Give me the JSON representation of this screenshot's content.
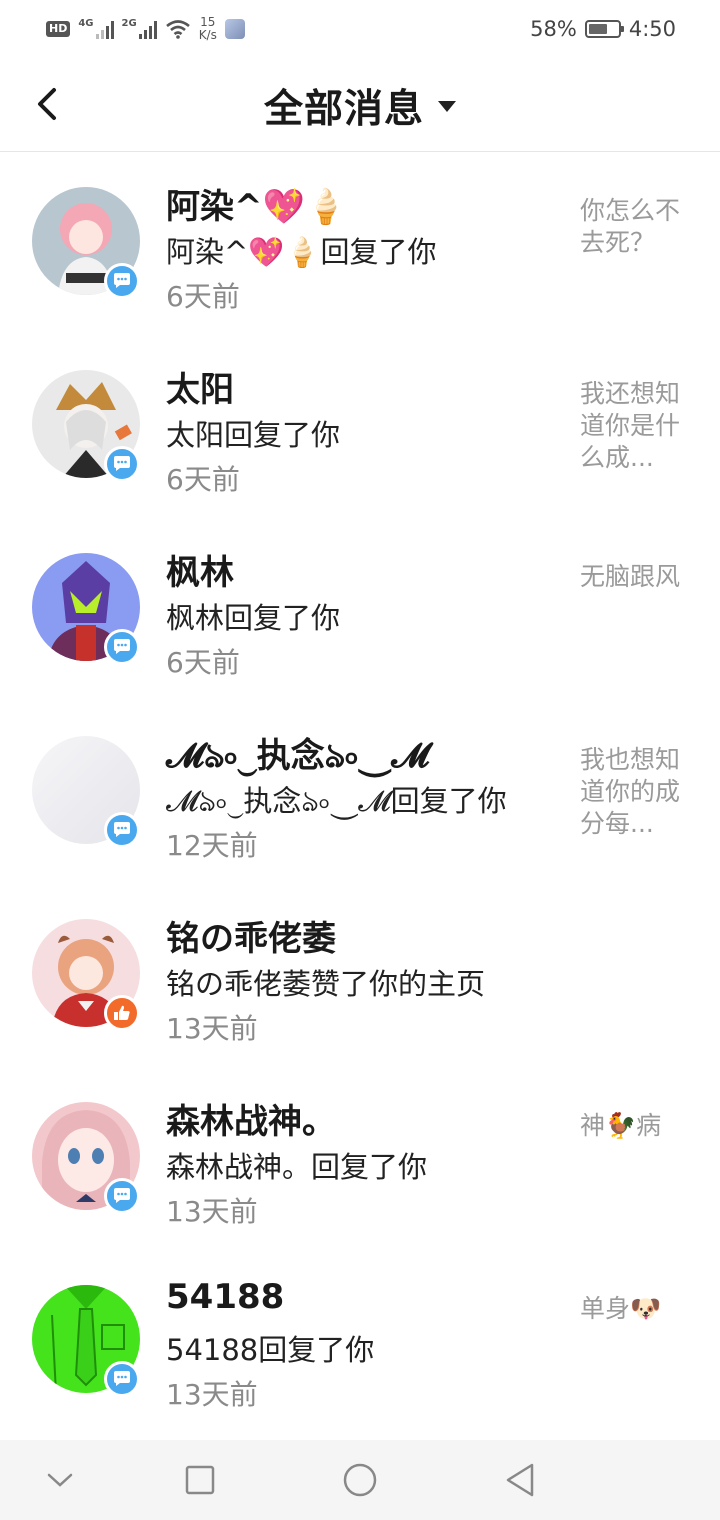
{
  "status_bar": {
    "hd": "HD",
    "net1": "4G",
    "net2": "2G",
    "speed_value": "15",
    "speed_unit": "K/s",
    "battery": "58%",
    "time": "4:50"
  },
  "header": {
    "title": "全部消息",
    "back_icon": "chevron-left-icon",
    "dropdown_icon": "caret-down-icon"
  },
  "messages": [
    {
      "name": "阿染^💖🍦",
      "action": "阿染^💖🍦回复了你",
      "time": "6天前",
      "preview": "你怎么不去死？",
      "badge": "reply"
    },
    {
      "name": "太阳",
      "action": "太阳回复了你",
      "time": "6天前",
      "preview": "我还想知道你是什么成...",
      "badge": "reply"
    },
    {
      "name": "枫林",
      "action": "枫林回复了你",
      "time": "6天前",
      "preview": "无脑跟风",
      "badge": "reply"
    },
    {
      "name": "𝓜ঌ৹⏝执念ঌ৹⏝𝓜",
      "action": "𝓜ঌ৹⏝执念ঌ৹⏝𝓜回复了你",
      "time": "12天前",
      "preview": "我也想知道你的成分每...",
      "badge": "reply"
    },
    {
      "name": "铭の乖佬萎",
      "action": "铭の乖佬萎赞了你的主页",
      "time": "13天前",
      "preview": "",
      "badge": "like"
    },
    {
      "name": "森林战神。",
      "action": "森林战神。回复了你",
      "time": "13天前",
      "preview": "神🐓病",
      "badge": "reply"
    },
    {
      "name": "54188",
      "action": "54188回复了你",
      "time": "13天前",
      "preview": "单身🐶",
      "badge": "reply"
    }
  ],
  "nav": {
    "items": [
      "collapse-icon",
      "recent-apps-icon",
      "home-icon",
      "back-icon"
    ]
  }
}
